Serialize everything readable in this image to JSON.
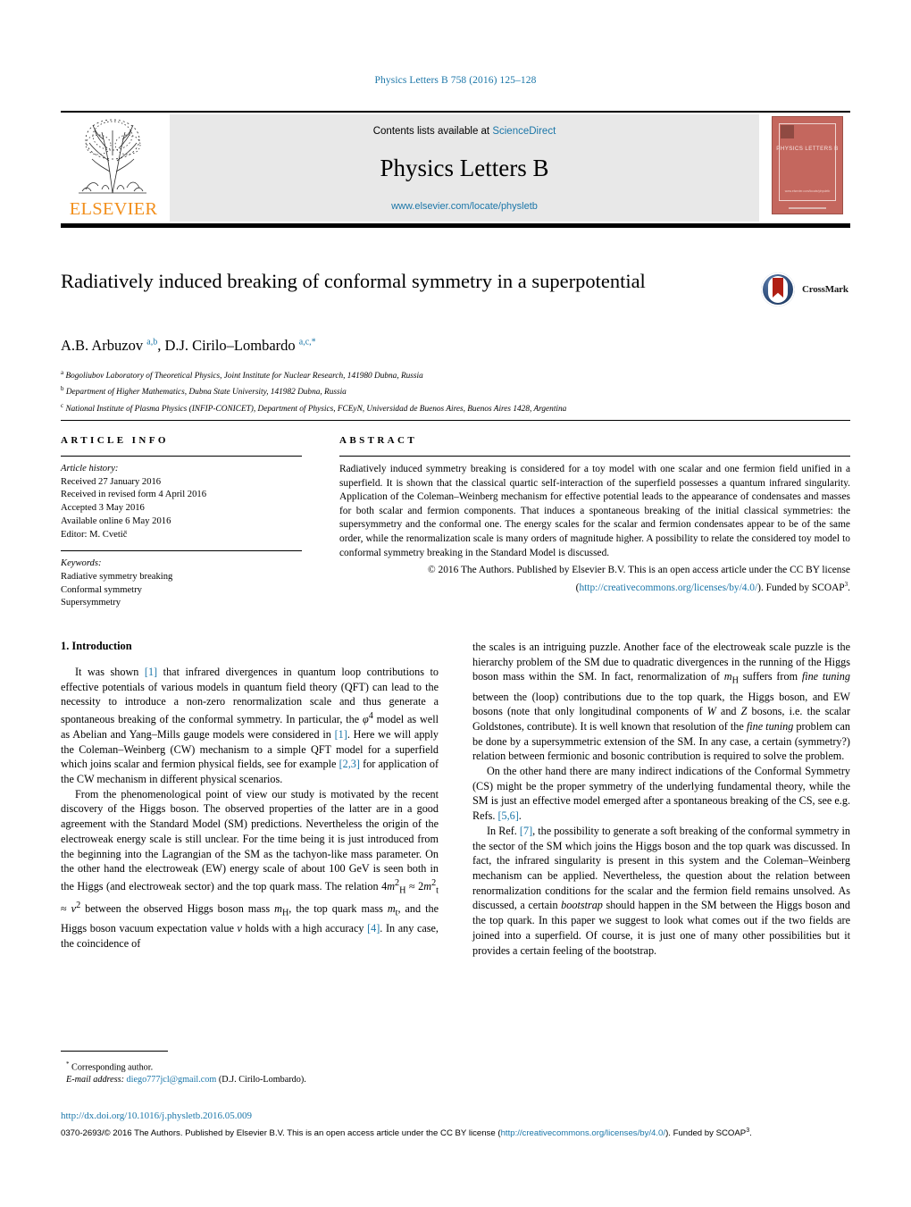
{
  "running_head": "Physics Letters B 758 (2016) 125–128",
  "masthead": {
    "contents_prefix": "Contents lists available at ",
    "sciencedirect": "ScienceDirect",
    "journal_title": "Physics Letters B",
    "journal_url": "www.elsevier.com/locate/physletb",
    "publisher": "ELSEVIER",
    "cover_title": "PHYSICS LETTERS B",
    "cover_footer": "www.elsevier.com/locate/physletb"
  },
  "article": {
    "title": "Radiatively induced breaking of conformal symmetry in a superpotential",
    "crossmark_label": "CrossMark",
    "authors_html": "A.B. Arbuzov <sup>a,b</sup>, D.J. Cirilo–Lombardo <sup>a,c,*</sup>",
    "affiliations": [
      {
        "mark": "a",
        "text": "Bogoliubov Laboratory of Theoretical Physics, Joint Institute for Nuclear Research, 141980 Dubna, Russia"
      },
      {
        "mark": "b",
        "text": "Department of Higher Mathematics, Dubna State University, 141982 Dubna, Russia"
      },
      {
        "mark": "c",
        "text": "National Institute of Plasma Physics (INFIP-CONICET), Department of Physics, FCEyN, Universidad de Buenos Aires, Buenos Aires 1428, Argentina"
      }
    ]
  },
  "article_info": {
    "heading": "ARTICLE INFO",
    "history_label": "Article history:",
    "history": [
      "Received 27 January 2016",
      "Received in revised form 4 April 2016",
      "Accepted 3 May 2016",
      "Available online 6 May 2016",
      "Editor: M. Cvetič"
    ],
    "keywords_label": "Keywords:",
    "keywords": [
      "Radiative symmetry breaking",
      "Conformal symmetry",
      "Supersymmetry"
    ]
  },
  "abstract": {
    "heading": "ABSTRACT",
    "text": "Radiatively induced symmetry breaking is considered for a toy model with one scalar and one fermion field unified in a superfield. It is shown that the classical quartic self-interaction of the superfield possesses a quantum infrared singularity. Application of the Coleman–Weinberg mechanism for effective potential leads to the appearance of condensates and masses for both scalar and fermion components. That induces a spontaneous breaking of the initial classical symmetries: the supersymmetry and the conformal one. The energy scales for the scalar and fermion condensates appear to be of the same order, while the renormalization scale is many orders of magnitude higher. A possibility to relate the considered toy model to conformal symmetry breaking in the Standard Model is discussed.",
    "copyright_prefix": "© 2016 The Authors. Published by Elsevier B.V. This is an open access article under the CC BY license",
    "license_open": "(",
    "license_url": "http://creativecommons.org/licenses/by/4.0/",
    "license_close": "). Funded by SCOAP",
    "license_sup": "3",
    "license_period": "."
  },
  "body": {
    "section1_title": "1. Introduction",
    "left_paragraphs": [
      "It was shown [1] that infrared divergences in quantum loop contributions to effective potentials of various models in quantum field theory (QFT) can lead to the necessity to introduce a non-zero renormalization scale and thus generate a spontaneous breaking of the conformal symmetry. In particular, the φ⁴ model as well as Abelian and Yang–Mills gauge models were considered in [1]. Here we will apply the Coleman–Weinberg (CW) mechanism to a simple QFT model for a superfield which joins scalar and fermion physical fields, see for example [2,3] for application of the CW mechanism in different physical scenarios.",
      "From the phenomenological point of view our study is motivated by the recent discovery of the Higgs boson. The observed properties of the latter are in a good agreement with the Standard Model (SM) predictions. Nevertheless the origin of the electroweak energy scale is still unclear. For the time being it is just introduced from the beginning into the Lagrangian of the SM as the tachyon-like mass parameter. On the other hand the electroweak (EW) energy scale of about 100 GeV is seen both in the Higgs (and electroweak sector) and the top quark mass. The relation 4m²_H ≈ 2m²_t ≈ v² between the observed Higgs boson mass m_H, the top quark mass m_t, and the Higgs boson vacuum expectation value v holds with a high accuracy [4]. In any case, the coincidence of"
    ],
    "right_paragraphs": [
      "the scales is an intriguing puzzle. Another face of the electroweak scale puzzle is the hierarchy problem of the SM due to quadratic divergences in the running of the Higgs boson mass within the SM. In fact, renormalization of m_H suffers from fine tuning between the (loop) contributions due to the top quark, the Higgs boson, and EW bosons (note that only longitudinal components of W and Z bosons, i.e. the scalar Goldstones, contribute). It is well known that resolution of the fine tuning problem can be done by a supersymmetric extension of the SM. In any case, a certain (symmetry?) relation between fermionic and bosonic contribution is required to solve the problem.",
      "On the other hand there are many indirect indications of the Conformal Symmetry (CS) might be the proper symmetry of the underlying fundamental theory, while the SM is just an effective model emerged after a spontaneous breaking of the CS, see e.g. Refs. [5,6].",
      "In Ref. [7], the possibility to generate a soft breaking of the conformal symmetry in the sector of the SM which joins the Higgs boson and the top quark was discussed. In fact, the infrared singularity is present in this system and the Coleman–Weinberg mechanism can be applied. Nevertheless, the question about the relation between renormalization conditions for the scalar and the fermion field remains unsolved. As discussed, a certain bootstrap should happen in the SM between the Higgs boson and the top quark. In this paper we suggest to look what comes out if the two fields are joined into a superfield. Of course, it is just one of many other possibilities but it provides a certain feeling of the bootstrap."
    ]
  },
  "footnote": {
    "marker": "*",
    "corresponding": "Corresponding author.",
    "email_label": "E-mail address:",
    "email": "diego777jcl@gmail.com",
    "email_suffix": "(D.J. Cirilo-Lombardo)."
  },
  "page_footer": {
    "doi": "http://dx.doi.org/10.1016/j.physletb.2016.05.009",
    "issn_copyright": "0370-2693/© 2016 The Authors. Published by Elsevier B.V. This is an open access article under the CC BY license (",
    "license_url": "http://creativecommons.org/licenses/by/4.0/",
    "after_license": "). Funded by",
    "scoap": "SCOAP",
    "scoap_sup": "3",
    "scoap_period": "."
  },
  "colors": {
    "link": "#1b76a8",
    "elsevier_orange": "#f28f1c",
    "cover_red": "#c4675e",
    "banner_gray": "#e8e8e8"
  }
}
